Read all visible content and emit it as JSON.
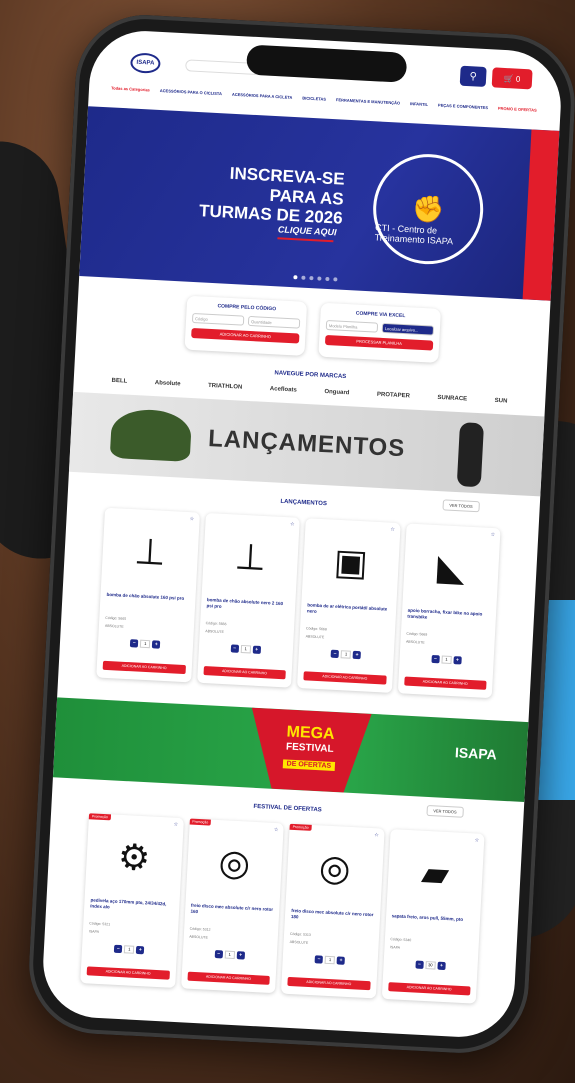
{
  "header": {
    "logo": "ISAPA",
    "categories_label": "Todas as Categorias",
    "nav_items": [
      "ACESSÓRIOS PARA O CICLISTA",
      "ACESSÓRIOS PARA A CICLETA",
      "BICICLETAS",
      "FERRAMENTAS E MANUTENÇÃO",
      "INFANTIL",
      "PEÇAS E COMPONENTES",
      "PROMO E OFERTAS"
    ],
    "cart_label": "0"
  },
  "hero": {
    "title": "INSCREVA-SE PARA AS TURMAS DE 2026",
    "cta": "CLIQUE AQUI",
    "emblem": "CTI - Centro de Treinamento ISAPA"
  },
  "buy_by_code": {
    "title": "COMPRE PELO CÓDIGO",
    "code_placeholder": "Código",
    "qty_placeholder": "Quantidade",
    "button": "ADICIONAR AO CARRINHO"
  },
  "buy_by_excel": {
    "title": "COMPRE VIA EXCEL",
    "file_label": "Modelo Planilha",
    "upload_button": "Localizar arquivo...",
    "button": "PROCESSAR PLANILHA"
  },
  "brands": {
    "title": "NAVEGUE POR MARCAS",
    "items": [
      "BELL",
      "Absolute",
      "TRIATHLON",
      "Acefloats",
      "Onguard",
      "PROTAPER",
      "SUNRACE",
      "SUN"
    ]
  },
  "lancamentos_banner": "LANÇAMENTOS",
  "lancamentos": {
    "title": "LANÇAMENTOS",
    "see_all": "VER TODOS",
    "products": [
      {
        "name": "bomba de chão absolute 160 psi pro",
        "code": "Código: 5665",
        "brand": "ABSOLUTE",
        "qty": "1",
        "add": "ADICIONAR AO CARRINHO"
      },
      {
        "name": "bomba de chão absolute nero 2 160 psi pro",
        "code": "Código: 5666",
        "brand": "ABSOLUTE",
        "qty": "1",
        "add": "ADICIONAR AO CARRINHO"
      },
      {
        "name": "bomba de ar elétrica portátil absolute nero",
        "code": "Código: 5668",
        "brand": "ABSOLUTE",
        "qty": "1",
        "add": "ADICIONAR AO CARRINHO"
      },
      {
        "name": "apoio borracha, fixar bike no apoio transbike",
        "code": "Código: 5669",
        "brand": "ABSOLUTE",
        "qty": "1",
        "add": "ADICIONAR AO CARRINHO"
      }
    ]
  },
  "mega": {
    "line1": "MEGA",
    "line2": "FESTIVAL",
    "line3": "DE OFERTAS",
    "brand": "ISAPA"
  },
  "festival": {
    "title": "FESTIVAL DE OFERTAS",
    "see_all": "VER TODOS",
    "promo_label": "Promoção",
    "products": [
      {
        "name": "pedivela aço 170mm pto, 24/34/42d, índex alo",
        "code": "Código: 5321",
        "brand": "ISAPA",
        "qty": "1",
        "add": "ADICIONAR AO CARRINHO"
      },
      {
        "name": "freio disco mec absolute c/r nero rotor 160",
        "code": "Código: 5312",
        "brand": "ABSOLUTE",
        "qty": "1",
        "add": "ADICIONAR AO CARRINHO"
      },
      {
        "name": "freio disco mec absolute c/r nero rotor 180",
        "code": "Código: 5313",
        "brand": "ABSOLUTE",
        "qty": "1",
        "add": "ADICIONAR AO CARRINHO"
      },
      {
        "name": "sapata freio, aros pull, 55mm, pto",
        "code": "Código: 5340",
        "brand": "ISAPA",
        "qty": "30",
        "add": "ADICIONAR AO CARRINHO"
      }
    ]
  }
}
